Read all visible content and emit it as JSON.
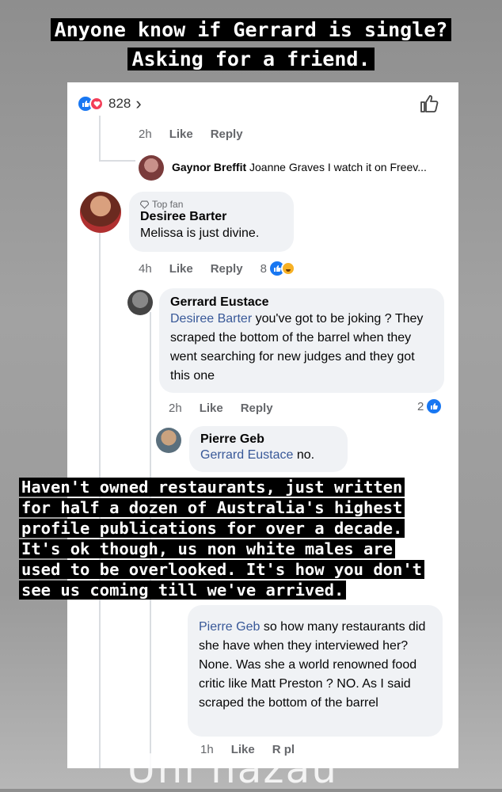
{
  "top_caption": {
    "line1": "Anyone know if Gerrard is single?",
    "line2": "Asking for a friend."
  },
  "post": {
    "reaction_count": "828"
  },
  "reply_top": {
    "time": "2h",
    "like": "Like",
    "reply": "Reply"
  },
  "gaynor": {
    "name": "Gaynor Breffit",
    "text": "Joanne Graves I watch it  on Freev..."
  },
  "desiree": {
    "badge": "Top fan",
    "name": "Desiree Barter",
    "text": "Melissa is just divine.",
    "time": "4h",
    "like": "Like",
    "reply": "Reply",
    "reactions": "8"
  },
  "gerrard": {
    "name": "Gerrard Eustace",
    "mention": "Desiree Barter",
    "text": " you've got to be joking ? They scraped the bottom of the barrel when they went searching for new judges and they got this one",
    "time": "2h",
    "like": "Like",
    "reply": "Reply",
    "reactions": "2"
  },
  "pierre": {
    "name": "Pierre Geb",
    "mention": "Gerrard Eustace",
    "text": " no."
  },
  "gerrard2": {
    "mention": "Pierre Geb",
    "text": " so how many restaurants did she have when they interviewed her? None. Was she a world renowned food critic like Matt Preston ? NO. As I said scraped the bottom of the barrel",
    "time": "1h",
    "like": "Like",
    "reply": "R pl"
  },
  "bottom_caption": {
    "line1": "Haven't owned restaurants, just written",
    "line2": "for half a dozen of Australia's highest",
    "line3": "profile publications for over a decade.",
    "line4": "It's ok though, us non white males are",
    "line5": "used to be overlooked. It's how you don't",
    "line6": "see us coming till we've arrived."
  },
  "watermark": "Uni hazau",
  "colors": {
    "facebook_blue": "#1877f2",
    "mention_blue": "#385898",
    "bubble_gray": "#f0f2f5",
    "caption_bg": "#000000"
  }
}
